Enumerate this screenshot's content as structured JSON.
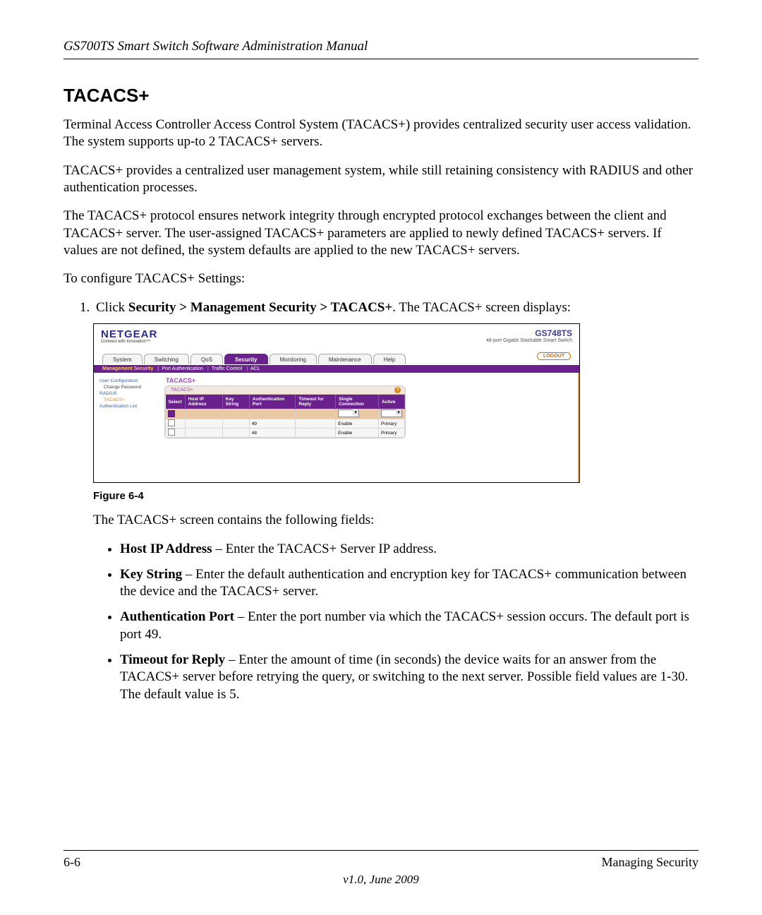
{
  "doc": {
    "running_header": "GS700TS Smart Switch Software Administration Manual",
    "section_title": "TACACS+",
    "para1": "Terminal Access Controller Access Control System (TACACS+) provides centralized security user access validation. The system supports up-to 2 TACACS+ servers.",
    "para2": "TACACS+ provides a centralized user management system, while still retaining consistency with RADIUS and other authentication processes.",
    "para3": "The TACACS+ protocol ensures network integrity through encrypted protocol exchanges between the client and TACACS+ server. The user-assigned TACACS+ parameters are applied to newly defined TACACS+ servers. If values are not defined, the system defaults are applied to the new TACACS+ servers.",
    "para4": "To configure TACACS+ Settings:",
    "step1_prefix": "Click ",
    "step1_bold": "Security > Management Security > TACACS+",
    "step1_suffix": ". The TACACS+ screen displays:",
    "fig_caption": "Figure 6-4",
    "after_fig": "The TACACS+ screen contains the following fields:",
    "fields": [
      {
        "name": "Host IP Address",
        "desc": " – Enter the TACACS+ Server IP address."
      },
      {
        "name": "Key String",
        "desc": " – Enter the default authentication and encryption key for TACACS+ communication between the device and the TACACS+ server."
      },
      {
        "name": "Authentication Port",
        "desc": " – Enter the port number via which the TACACS+ session occurs. The default port is port 49."
      },
      {
        "name": "Timeout for Reply",
        "desc": " – Enter the amount of time (in seconds) the device waits for an answer from the TACACS+ server before retrying the query, or switching to the next server. Possible field values are 1-30. The default value is 5."
      }
    ],
    "footer_left": "6-6",
    "footer_right": "Managing Security",
    "footer_version": "v1.0, June 2009"
  },
  "shot": {
    "brand": "NETGEAR",
    "brand_sub": "Connect with Innovation™",
    "product_model": "GS748TS",
    "product_desc": "48-port Gigabit Stackable Smart Switch",
    "tabs": [
      "System",
      "Switching",
      "QoS",
      "Security",
      "Monitoring",
      "Maintenance",
      "Help"
    ],
    "active_tab_index": 3,
    "logout": "LOGOUT",
    "subtabs": [
      "Management Security",
      "Port Authentication",
      "Traffic Control",
      "ACL"
    ],
    "active_subtab_index": 0,
    "sidenav": {
      "groups": [
        {
          "label": "User Configuration",
          "type": "grp"
        },
        {
          "label": "Change Password",
          "type": "sub"
        },
        {
          "label": "RADIUS",
          "type": "grp"
        },
        {
          "label": "TACACS+",
          "type": "sel"
        },
        {
          "label": "Authentication List",
          "type": "grp"
        }
      ]
    },
    "panel_title": "TACACS+",
    "panel_tab": "TACACS+",
    "table": {
      "headers": [
        "Select",
        "Host IP Address",
        "Key String",
        "Authentication Port",
        "Timeout for Reply",
        "Single Connection",
        "Active"
      ],
      "rows": [
        {
          "select": "",
          "host": "",
          "key": "",
          "port": "49",
          "timeout": "",
          "single": "Enable",
          "active": "Primary"
        },
        {
          "select": "",
          "host": "",
          "key": "",
          "port": "48",
          "timeout": "",
          "single": "Enable",
          "active": "Primary"
        }
      ]
    }
  }
}
